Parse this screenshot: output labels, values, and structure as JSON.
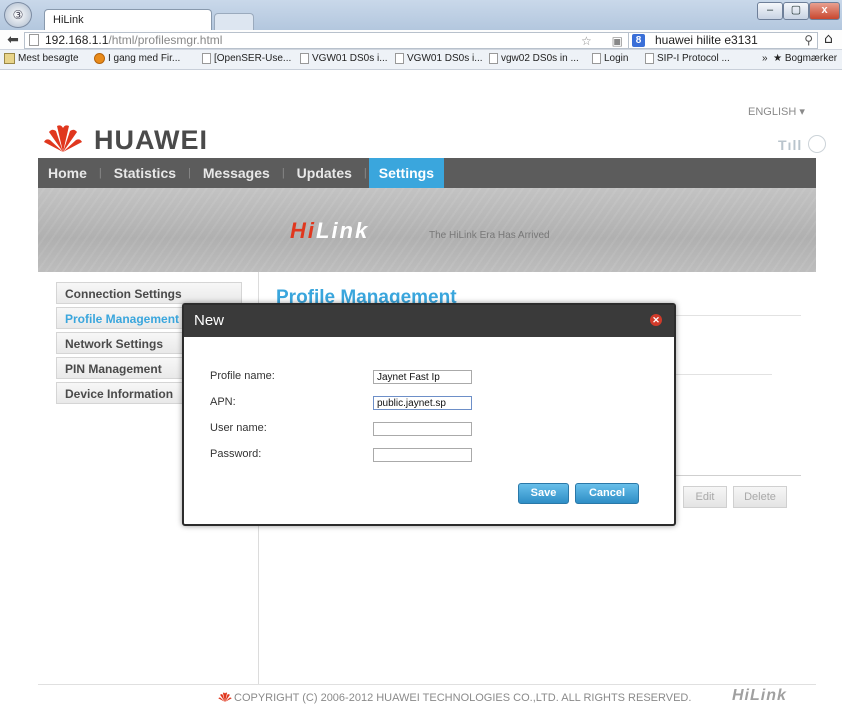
{
  "browser": {
    "tab_title": "HiLink",
    "back_glyph": "⬅",
    "url_host": "192.168.1.1",
    "url_path": "/html/profilesmgr.html",
    "url_icons": "☆ ▣ C",
    "search_engine_letter": "8",
    "search_text": "huawei hilite e3131",
    "search_glyph": "⚲",
    "home_glyph": "⌂",
    "window_controls": {
      "minimize": "–",
      "maximize": "▢",
      "close": "x"
    },
    "bookmarks": [
      {
        "label": "Mest besøgte",
        "icon": "most-visited-icon"
      },
      {
        "label": "I gang med Fir...",
        "icon": "firefox-icon"
      },
      {
        "label": "[OpenSER-Use...",
        "icon": "page-icon"
      },
      {
        "label": "VGW01 DS0s i...",
        "icon": "page-icon"
      },
      {
        "label": "VGW01 DS0s i...",
        "icon": "page-icon"
      },
      {
        "label": "vgw02 DS0s in ...",
        "icon": "page-icon"
      },
      {
        "label": "Login",
        "icon": "page-icon"
      },
      {
        "label": "SIP-I Protocol ...",
        "icon": "page-icon"
      }
    ],
    "bookmarks_more": "»",
    "bookmarks_folder": "★ Bogmærker"
  },
  "header": {
    "language": "ENGLISH ▾",
    "brand": "HUAWEI",
    "signal_glyph": "Tıll"
  },
  "nav": {
    "items": [
      "Home",
      "Statistics",
      "Messages",
      "Updates",
      "Settings"
    ],
    "active": "Settings"
  },
  "banner": {
    "logo_hi": "Hi",
    "logo_link": "Link",
    "tagline": "The HiLink Era Has Arrived"
  },
  "sidebar": {
    "items": [
      "Connection Settings",
      "Profile Management",
      "Network Settings",
      "PIN Management",
      "Device Information"
    ],
    "active_index": 1
  },
  "content": {
    "title": "Profile Management",
    "edit_label": "Edit",
    "delete_label": "Delete"
  },
  "dialog": {
    "title": "New",
    "close_glyph": "✕",
    "fields": {
      "profile_name_label": "Profile name:",
      "profile_name_value": "Jaynet Fast Ip",
      "apn_label": "APN:",
      "apn_value": "public.jaynet.sp",
      "username_label": "User name:",
      "username_value": "",
      "password_label": "Password:",
      "password_value": ""
    },
    "save_label": "Save",
    "cancel_label": "Cancel"
  },
  "footer": {
    "copyright": "COPYRIGHT (C) 2006-2012 HUAWEI TECHNOLOGIES CO.,LTD. ALL RIGHTS RESERVED.",
    "logo": "HiLink"
  },
  "colors": {
    "accent_blue": "#3aa6dd",
    "huawei_red": "#e0371e",
    "nav_gray": "#5c5c5c"
  }
}
